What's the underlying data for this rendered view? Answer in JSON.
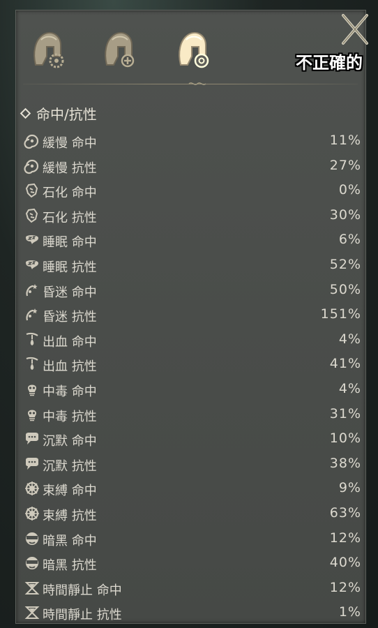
{
  "overlay": {
    "text": "不正確的"
  },
  "tabs": [
    {
      "name": "helmet-gear-tab",
      "active": false
    },
    {
      "name": "helmet-plus-tab",
      "active": false
    },
    {
      "name": "helmet-eye-tab",
      "active": true
    }
  ],
  "section": {
    "title": "命中/抗性"
  },
  "rows": [
    {
      "icon": "slow-icon",
      "label": "緩慢 命中",
      "value": "11%"
    },
    {
      "icon": "slow-icon",
      "label": "緩慢 抗性",
      "value": "27%"
    },
    {
      "icon": "petrify-icon",
      "label": "石化 命中",
      "value": "0%"
    },
    {
      "icon": "petrify-icon",
      "label": "石化 抗性",
      "value": "30%"
    },
    {
      "icon": "sleep-icon",
      "label": "睡眠 命中",
      "value": "6%"
    },
    {
      "icon": "sleep-icon",
      "label": "睡眠 抗性",
      "value": "52%"
    },
    {
      "icon": "stun-icon",
      "label": "昏迷 命中",
      "value": "50%"
    },
    {
      "icon": "stun-icon",
      "label": "昏迷 抗性",
      "value": "151%"
    },
    {
      "icon": "bleed-icon",
      "label": "出血 命中",
      "value": "4%"
    },
    {
      "icon": "bleed-icon",
      "label": "出血 抗性",
      "value": "41%"
    },
    {
      "icon": "poison-icon",
      "label": "中毒 命中",
      "value": "4%"
    },
    {
      "icon": "poison-icon",
      "label": "中毒 抗性",
      "value": "31%"
    },
    {
      "icon": "silence-icon",
      "label": "沉默 命中",
      "value": "10%"
    },
    {
      "icon": "silence-icon",
      "label": "沉默 抗性",
      "value": "38%"
    },
    {
      "icon": "bind-icon",
      "label": "束縛 命中",
      "value": "9%"
    },
    {
      "icon": "bind-icon",
      "label": "束縛 抗性",
      "value": "63%"
    },
    {
      "icon": "blind-icon",
      "label": "暗黑 命中",
      "value": "12%"
    },
    {
      "icon": "blind-icon",
      "label": "暗黑 抗性",
      "value": "40%"
    },
    {
      "icon": "time-stop-icon",
      "label": "時間靜止 命中",
      "value": "12%"
    },
    {
      "icon": "time-stop-icon",
      "label": "時間靜止 抗性",
      "value": "1%"
    }
  ]
}
